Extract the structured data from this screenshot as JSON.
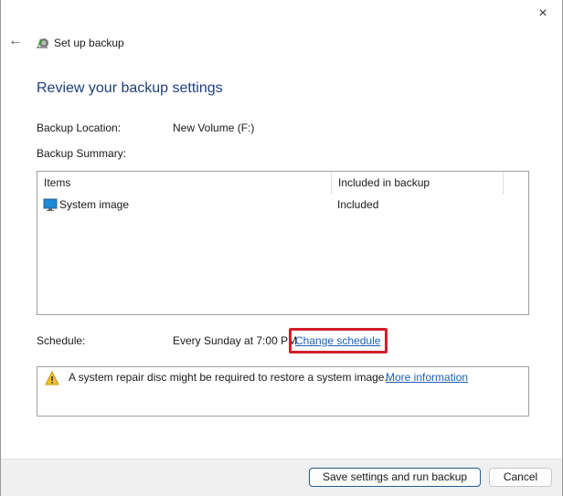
{
  "window": {
    "close_icon": "×",
    "title": "Set up backup"
  },
  "heading": "Review your backup settings",
  "backup_location": {
    "label": "Backup Location:",
    "value": "New Volume (F:)"
  },
  "backup_summary": {
    "label": "Backup Summary:",
    "columns": [
      "Items",
      "Included in backup"
    ],
    "rows": [
      {
        "item": "System image",
        "included": "Included"
      }
    ]
  },
  "schedule": {
    "label": "Schedule:",
    "value": "Every Sunday at 7:00 PM",
    "change_link": "Change schedule"
  },
  "warning": {
    "text": "A system repair disc might be required to restore a system image.",
    "link": "More information"
  },
  "buttons": {
    "save": "Save settings and run backup",
    "cancel": "Cancel"
  },
  "colors": {
    "heading": "#1e3f78",
    "link": "#1a5fb4",
    "highlight": "#d2202a"
  }
}
